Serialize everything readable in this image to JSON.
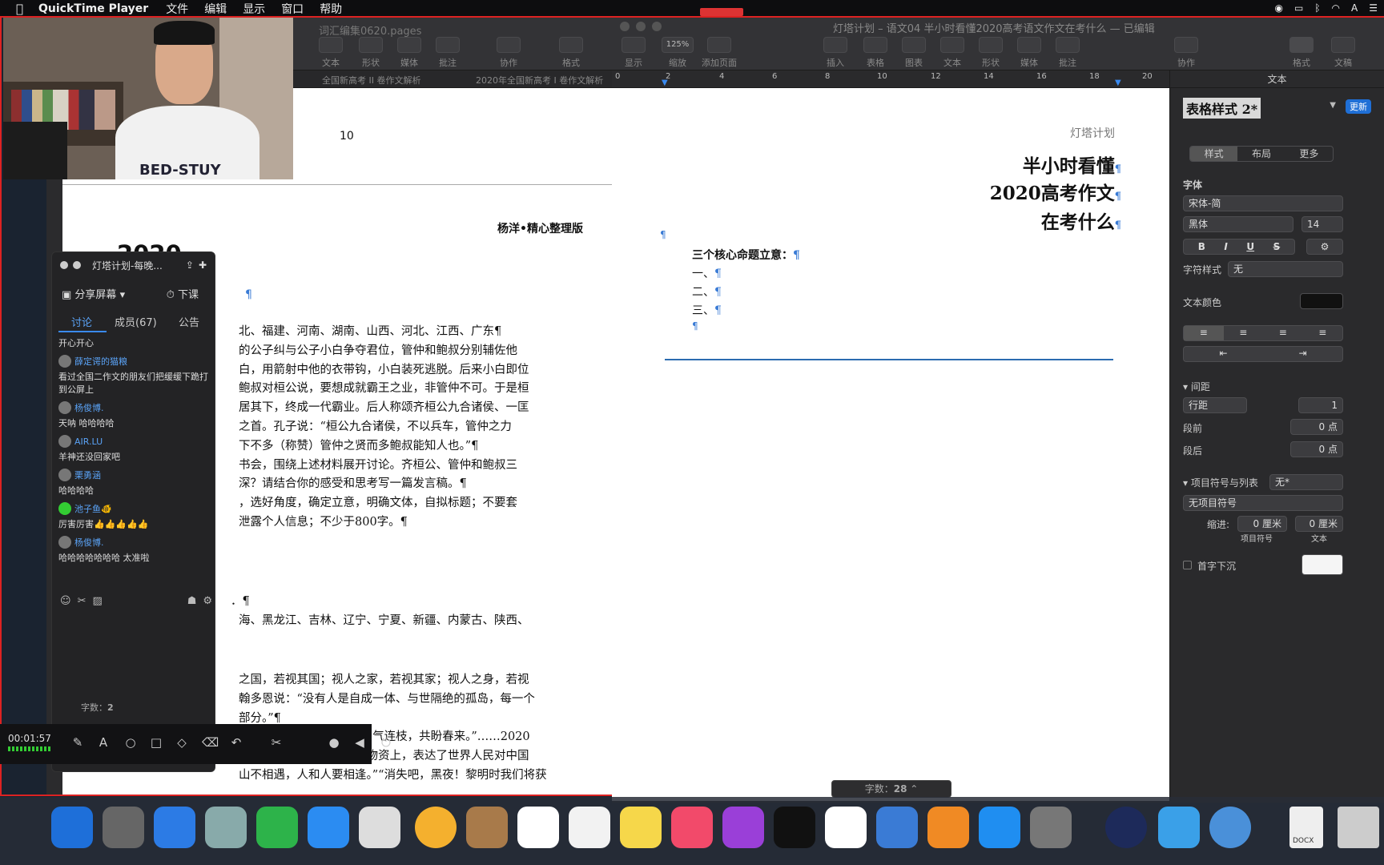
{
  "menubar": {
    "app": "QuickTime Player",
    "menus": [
      "文件",
      "编辑",
      "显示",
      "窗口",
      "帮助"
    ]
  },
  "left_window": {
    "title": "词汇编集0620.pages",
    "toolbar": [
      "文本",
      "形状",
      "媒体",
      "批注",
      "协作",
      "格式"
    ],
    "tabs": [
      "全国新高考 II 卷作文解析",
      "2020年全国新高考 I 卷作文解析"
    ],
    "page_number": "10",
    "byline": "杨洋•精心整理版",
    "year": "2020",
    "lines": [
      "北、福建、河南、湖南、山西、河北、江西、广东¶",
      "的公子纠与公子小白争夺君位，管仲和鲍叔分别辅佐他",
      "白，用箭射中他的衣带钩，小白装死逃脱。后来小白即位",
      "鲍叔对桓公说，要想成就霸王之业，非管仲不可。于是桓",
      "居其下，终成一代霸业。后人称颂齐桓公九合诸侯、一匡",
      "之首。孔子说：“桓公九合诸侯，不以兵车，管仲之力",
      "下不多（称赞）管仲之贤而多鲍叔能知人也。”¶",
      "书会，围绕上述材料展开讨论。齐桓公、管仲和鲍叔三",
      "深？请结合你的感受和思考写一篇发言稿。¶",
      "，选好角度，确定立意，明确文体，自拟标题；不要套",
      "泄露个人信息；不少于800字。¶"
    ],
    "lines2": [
      "．¶",
      "海、黑龙江、吉林、辽宁、宁夏、新疆、内蒙古、陕西、"
    ],
    "lines3": [
      "之国，若视其国；视人之家，若视其家；视人之身，若视",
      "翰多恩说：“没有人是自成一体、与世隔绝的孤岛，每一个",
      "部分。”¶",
      "雨，明月何曾是两乡。”“同气连枝，共盼春来。”……2020",
      "印在国际社会援助中国的物资上，表达了世界人民对中国",
      "山不相遇，人和人要相逢。”“消失吧，黑夜！黎明时我们将获"
    ]
  },
  "right_window": {
    "title": "灯塔计划 – 语文04 半小时看懂2020高考语文作文在考什么 — 已编辑",
    "toolbar": [
      "显示",
      "缩放",
      "添加页面",
      "插入",
      "表格",
      "图表",
      "文本",
      "形状",
      "媒体",
      "批注",
      "协作",
      "格式",
      "文稿"
    ],
    "zoom": "125%",
    "ruler": [
      "0",
      "2",
      "4",
      "6",
      "8",
      "10",
      "12",
      "14",
      "16",
      "18",
      "20"
    ],
    "brand": "灯塔计划",
    "heading": [
      "半小时看懂",
      "2020高考作文",
      "在考什么"
    ],
    "core": "三个核心命题立意：",
    "items": [
      "一、",
      "二、",
      "三、"
    ],
    "word_count_label": "字数：",
    "word_count": "28"
  },
  "inspector": {
    "header": "文本",
    "style_name": "表格样式 2*",
    "update": "更新",
    "segments": [
      "样式",
      "布局",
      "更多"
    ],
    "font_label": "字体",
    "font_family": "宋体-简",
    "font_weight": "黑体",
    "font_size": "14",
    "b": "B",
    "i": "I",
    "u": "U",
    "s": "S",
    "char_style_label": "字符样式",
    "char_style": "无",
    "text_color_label": "文本颜色",
    "spacing_label": "间距",
    "line_spacing": "行距",
    "line_spacing_value": "1",
    "before_label": "段前",
    "before_value": "0 点",
    "after_label": "段后",
    "after_value": "0 点",
    "bullets_label": "项目符号与列表",
    "bullets_value": "无*",
    "no_bullets": "无项目符号",
    "indent_label": "缩进:",
    "indent_bullet": "0 厘米",
    "indent_text": "0 厘米",
    "indent_bullet_label": "项目符号",
    "indent_text_label": "文本",
    "dropcap_label": "首字下沉"
  },
  "chat": {
    "title": "灯塔计划-每晚...",
    "share": "分享屏幕",
    "end_class": "下课",
    "tabs": [
      "讨论",
      "成员(67)",
      "公告"
    ],
    "messages": [
      {
        "name": "",
        "text": "开心开心"
      },
      {
        "name": "薛定谔的猫粮",
        "text": "看过全国二作文的朋友们把缓缓下跪打到公屏上"
      },
      {
        "name": "杨俊博.",
        "text": "天呐 哈哈哈哈"
      },
      {
        "name": "AIR.LU",
        "text": "羊神还没回家吧"
      },
      {
        "name": "栗勇涵",
        "text": "哈哈哈哈"
      },
      {
        "name": "池子鱼🐠",
        "text": "厉害厉害👍👍👍👍👍"
      },
      {
        "name": "杨俊博.",
        "text": "哈哈哈哈哈哈哈 太准啦"
      }
    ],
    "word_count_label": "字数：",
    "word_count": "2"
  },
  "recording": {
    "time": "00:01:57"
  },
  "webcam": {
    "shirt_text": "BED-STUY"
  },
  "dock": {
    "docx_label": "DOCX"
  }
}
